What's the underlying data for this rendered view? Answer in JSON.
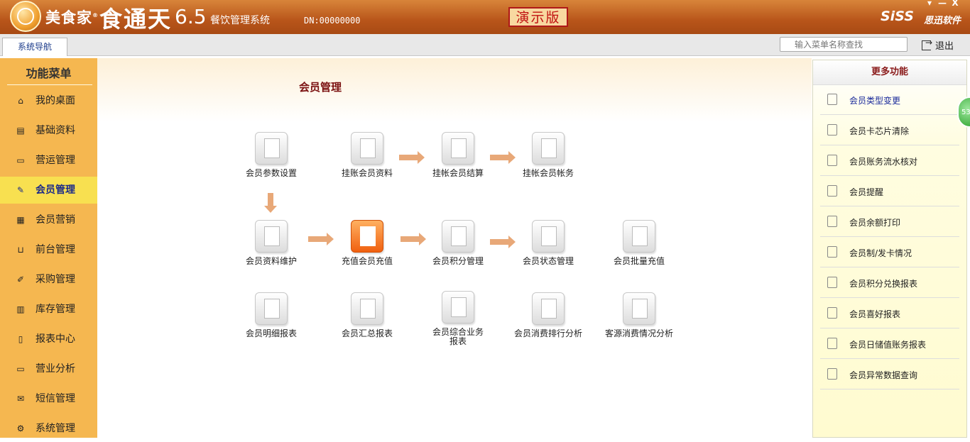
{
  "window": {
    "brand": "美食家",
    "brand_mark": "®",
    "product": "食通天",
    "version": "6.5",
    "subtitle": "餐饮管理系统",
    "dn": "DN:00000000",
    "demo_label": "演示版",
    "company_logo": "SiSS",
    "company_name": "思迅软件",
    "controls": [
      "▾",
      "—",
      "X"
    ]
  },
  "tabs": {
    "nav_tab": "系统导航",
    "search_placeholder": "输入菜单名称查找",
    "exit_label": "退出"
  },
  "left_menu": {
    "title": "功能菜单",
    "items": [
      {
        "label": "我的桌面",
        "icon": "home-icon",
        "glyph": "⌂"
      },
      {
        "label": "基础资料",
        "icon": "database-icon",
        "glyph": "▤"
      },
      {
        "label": "营运管理",
        "icon": "folder-icon",
        "glyph": "▭"
      },
      {
        "label": "会员管理",
        "icon": "edit-icon",
        "glyph": "✎",
        "active": true
      },
      {
        "label": "会员营销",
        "icon": "calculator-icon",
        "glyph": "▦"
      },
      {
        "label": "前台管理",
        "icon": "cart-icon",
        "glyph": "⊔"
      },
      {
        "label": "采购管理",
        "icon": "wrench-icon",
        "glyph": "✐"
      },
      {
        "label": "库存管理",
        "icon": "store-icon",
        "glyph": "▥"
      },
      {
        "label": "报表中心",
        "icon": "document-icon",
        "glyph": "▯"
      },
      {
        "label": "营业分析",
        "icon": "folder-icon",
        "glyph": "▭"
      },
      {
        "label": "短信管理",
        "icon": "mail-icon",
        "glyph": "✉"
      },
      {
        "label": "系统管理",
        "icon": "gear-icon",
        "glyph": "⚙"
      }
    ]
  },
  "main": {
    "title": "会员管理",
    "items": [
      {
        "label": "会员参数设置",
        "icon": "settings-user-icon"
      },
      {
        "label": "挂账会员资料",
        "icon": "money-icon"
      },
      {
        "label": "挂帐会员结算",
        "icon": "invoice-icon"
      },
      {
        "label": "挂帐会员帐务",
        "icon": "money-stack-icon"
      },
      {
        "label": "会员资料维护",
        "icon": "member-card-icon"
      },
      {
        "label": "充值会员充值",
        "icon": "recharge-document-icon"
      },
      {
        "label": "会员积分管理",
        "icon": "growth-chart-icon"
      },
      {
        "label": "会员状态管理",
        "icon": "status-chart-icon"
      },
      {
        "label": "会员批量充值",
        "icon": "batch-invoice-icon"
      },
      {
        "label": "会员明细报表",
        "icon": "star-report-icon"
      },
      {
        "label": "会员汇总报表",
        "icon": "search-report-icon"
      },
      {
        "label": "会员综合业务报表",
        "icon": "printer-icon"
      },
      {
        "label": "会员消费排行分析",
        "icon": "star-report-icon"
      },
      {
        "label": "客源消费情况分析",
        "icon": "search-report-icon"
      }
    ]
  },
  "right_panel": {
    "title": "更多功能",
    "items": [
      "会员类型变更",
      "会员卡芯片清除",
      "会员账务流水核对",
      "会员提醒",
      "会员余额打印",
      "会员制/发卡情况",
      "会员积分兑换报表",
      "会员喜好报表",
      "会员日储值账务报表",
      "会员异常数据查询"
    ],
    "icons": [
      "clipboard-icon",
      "search-icon",
      "card-icon",
      "layers-icon",
      "clipboard-icon",
      "bag-icon",
      "clipboard-icon",
      "filter-icon",
      "search-icon",
      "card-icon"
    ]
  },
  "badge": {
    "text": "53"
  },
  "colors": {
    "titlebar": "#b8551a",
    "menu_bg": "#f5b750",
    "menu_active": "#f8e050",
    "arrow": "#e8a878",
    "demo_red": "#c01010"
  }
}
